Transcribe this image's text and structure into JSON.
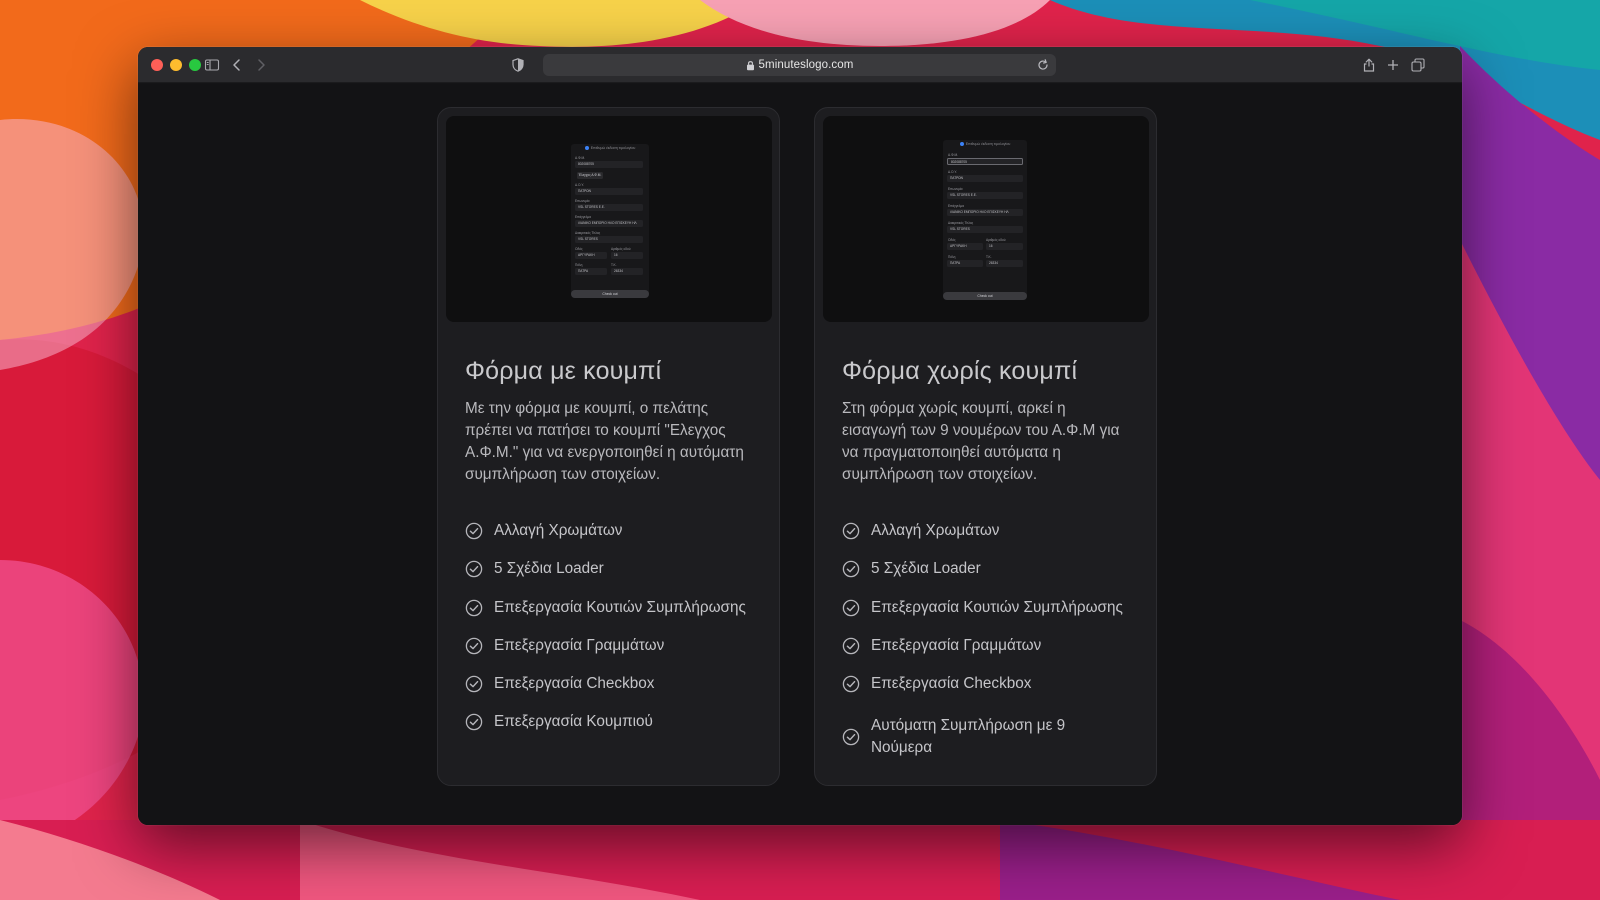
{
  "browser": {
    "url": "5minuteslogo.com"
  },
  "cards": [
    {
      "title": "Φόρμα με κουμπί",
      "description": "Με την φόρμα με κουμπί, ο πελάτης πρέπει να πατήσει το κουμπί \"Ελεγχος Α.Φ.Μ.\" για να ενεργοποιηθεί η αυτόματη συμπλήρωση των στοιχείων.",
      "features": [
        "Αλλαγή Χρωμάτων",
        "5 Σχέδια Loader",
        "Επεξεργασία Κουτιών Συμπλήρωσης",
        "Επεξεργασία Γραμμάτων",
        "Επεξεργασία Checkbox",
        "Επεξεργασία Κουμπιού"
      ],
      "preview": {
        "header": "Επιθυμώ έκδοση τιμολογίου",
        "afm_label": "Α.Φ.Μ.",
        "afm_value": "802088705",
        "check_button": "Έλεγχος Α.Φ.Μ.",
        "doy_label": "Δ.Ο.Υ.",
        "doy_value": "ΠΑΤΡΩΝ",
        "company_label": "Επωνυμία",
        "company_value": "VSL STORES Ε.Ε.",
        "activity_label": "Επάγγελμα",
        "activity_value": "ΛΙΑΝΙΚΟ ΕΜΠΟΡΙΟ ΗΛΟ ΕΠΙΣΚΕΥΗ ΗΛ",
        "distinct_label": "Διακριτικός Τίτλος",
        "distinct_value": "VSL STORES",
        "street_label": "Οδός",
        "street_value": "ΑΡΓΥΡΑΚΗ",
        "number_label": "Αριθμός οδού",
        "number_value": "16",
        "city_label": "Πόλη",
        "city_value": "ΠΑΤΡΑ",
        "zip_label": "Τ.Κ.",
        "zip_value": "26334",
        "submit": "Check out"
      }
    },
    {
      "title": "Φόρμα χωρίς κουμπί",
      "description": "Στη φόρμα χωρίς κουμπί, αρκεί η εισαγωγή των 9 νουμέρων του Α.Φ.Μ για να πραγματοποιηθεί αυτόματα η συμπλήρωση των στοιχείων.",
      "features": [
        "Αλλαγή Χρωμάτων",
        "5 Σχέδια Loader",
        "Επεξεργασία Κουτιών Συμπλήρωσης",
        "Επεξεργασία Γραμμάτων",
        "Επεξεργασία Checkbox",
        "Αυτόματη Συμπλήρωση με 9 Νούμερα"
      ],
      "preview": {
        "header": "Επιθυμώ έκδοση τιμολογίου",
        "afm_label": "Α.Φ.Μ.",
        "afm_value": "802088705",
        "doy_label": "Δ.Ο.Υ.",
        "doy_value": "ΠΑΤΡΩΝ",
        "company_label": "Επωνυμία",
        "company_value": "VSL STORES Ε.Ε.",
        "activity_label": "Επάγγελμα",
        "activity_value": "ΛΙΑΝΙΚΟ ΕΜΠΟΡΙΟ ΗΛΟ ΕΠΙΣΚΕΥΗ ΗΛ",
        "distinct_label": "Διακριτικός Τίτλος",
        "distinct_value": "VSL STORES",
        "street_label": "Οδός",
        "street_value": "ΑΡΓΥΡΑΚΗ",
        "number_label": "Αριθμός οδού",
        "number_value": "16",
        "city_label": "Πόλη",
        "city_value": "ΠΑΤΡΑ",
        "zip_label": "Τ.Κ.",
        "zip_value": "26334",
        "submit": "Check out"
      }
    }
  ],
  "icons": {
    "feature_check": "check-circle-icon",
    "sidebar": "sidebar-icon",
    "back": "chevron-left-icon",
    "forward": "chevron-right-icon",
    "shield": "shield-icon",
    "lock": "lock-icon",
    "reload": "reload-icon",
    "share": "share-icon",
    "new_tab": "plus-icon",
    "tabs": "tabs-overview-icon"
  },
  "colors": {
    "page_background": "#131315",
    "card_background": "#1d1d20",
    "text_primary": "#c9c9cc",
    "accent_dot": "#3b82f6",
    "traffic_red": "#fe5f57",
    "traffic_yellow": "#febc2e",
    "traffic_green": "#28c840"
  }
}
